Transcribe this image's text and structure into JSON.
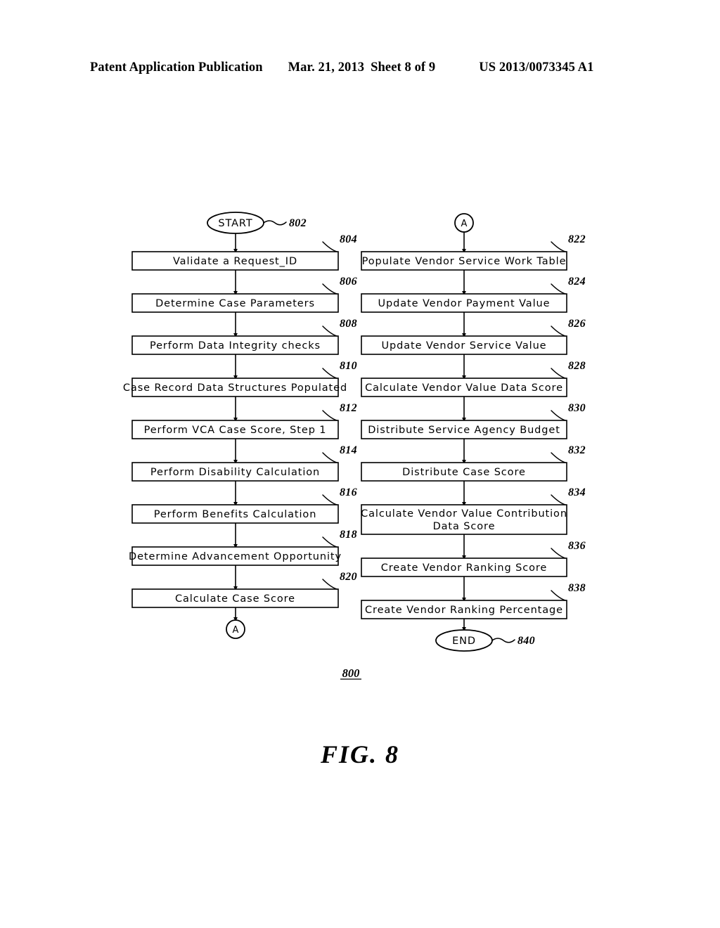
{
  "header": {
    "publication": "Patent Application Publication",
    "date": "Mar. 21, 2013",
    "sheet": "Sheet 8 of 9",
    "patent_number": "US 2013/0073345 A1"
  },
  "figure": {
    "caption": "FIG. 8",
    "figure_ref": "800",
    "columns": [
      {
        "id": "left-column",
        "start_node": {
          "label": "START",
          "ref": "802"
        },
        "steps": [
          {
            "ref": "804",
            "label": "Validate a  Request_ID"
          },
          {
            "ref": "806",
            "label": "Determine Case  Parameters"
          },
          {
            "ref": "808",
            "label": "Perform Data  Integrity checks"
          },
          {
            "ref": "810",
            "label": "Case Record Data Structures Populated"
          },
          {
            "ref": "812",
            "label": "Perform VCA Case Score, Step 1"
          },
          {
            "ref": "814",
            "label": "Perform Disability Calculation"
          },
          {
            "ref": "816",
            "label": "Perform Benefits Calculation"
          },
          {
            "ref": "818",
            "label": "Determine Advancement Opportunity"
          },
          {
            "ref": "820",
            "label": "Calculate Case Score"
          }
        ],
        "end_node": {
          "label": "A",
          "ref": ""
        }
      },
      {
        "id": "right-column",
        "start_node": {
          "label": "A",
          "ref": ""
        },
        "steps": [
          {
            "ref": "822",
            "label": "Populate Vendor Service Work Table"
          },
          {
            "ref": "824",
            "label": "Update Vendor Payment Value"
          },
          {
            "ref": "826",
            "label": "Update Vendor Service Value"
          },
          {
            "ref": "828",
            "label": "Calculate Vendor Value Data Score"
          },
          {
            "ref": "830",
            "label": "Distribute Service Agency Budget"
          },
          {
            "ref": "832",
            "label": "Distribute Case Score"
          },
          {
            "ref": "834",
            "label": "Calculate Vendor Value Contribution",
            "label2": "Data  Score"
          },
          {
            "ref": "836",
            "label": "Create Vendor Ranking Score"
          },
          {
            "ref": "838",
            "label": "Create Vendor Ranking Percentage"
          }
        ],
        "end_node": {
          "label": "END",
          "ref": "840"
        }
      }
    ]
  },
  "colors": {
    "ink": "#000000",
    "paper": "#ffffff"
  }
}
